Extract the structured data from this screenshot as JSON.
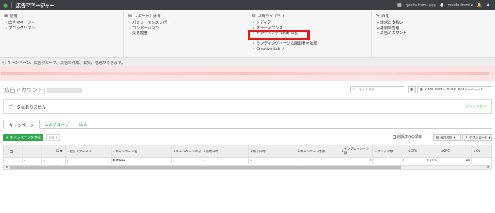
{
  "app": {
    "title": "広告マネージャー",
    "user1": "ryuuta izumi",
    "user1_role": "管理者",
    "user2": "ryuuta izumi ▾"
  },
  "menu": {
    "manage": {
      "heading": "管理",
      "items": [
        "広告マネージャー",
        "ブロックリスト"
      ]
    },
    "reports": {
      "heading": "レポートと計測",
      "items": [
        "パフォーマンスレポート",
        "コンバージョン",
        "変更履歴"
      ]
    },
    "library": {
      "heading": "共有ライブラリ",
      "items": [
        "メディア",
        "オーディエンス",
        "トラッキング(LINE Tag)",
        "",
        "ランディングページの画面審を依頼",
        "Creative Lab"
      ]
    },
    "settings": {
      "heading": "設定",
      "items": [
        "請求と支払い",
        "権限の管理",
        "広告アカウント"
      ]
    }
  },
  "info": {
    "notice": "キャンペーン、広告グループ、広告の作成、編集、管理ができます。"
  },
  "account": {
    "label": "広告アカウント:",
    "search_placeholder": "名前を検索",
    "date_range": "2020/10/9 - 2020/10/9",
    "timezone": "(Asia/Tokyo)"
  },
  "nodata": {
    "message": "データはありません",
    "right_link": "グラフを表示"
  },
  "tabs": [
    {
      "label": "キャンペーン",
      "active": true
    },
    {
      "label": "広告グループ",
      "active": false
    },
    {
      "label": "広告",
      "active": false
    }
  ],
  "toolbar": {
    "create_label": "キャンペーンを作成",
    "edit_label": "編集 ▾",
    "show_deleted": "削除済みの項目",
    "columns_label": "表示項目 ▾",
    "download_label": "ダウンロード ▾"
  },
  "table": {
    "headers": [
      "",
      "",
      "",
      "ID ◆",
      "配信ステータス",
      "キャンペーン名",
      "キャンペーン目的",
      "開始日時",
      "終了日時",
      "キャンペーン予算",
      "インプレッション数",
      "クリック数",
      "CTR",
      "CPC",
      "CV"
    ],
    "row": [
      "",
      "-",
      "-",
      "-",
      "-",
      "0 items",
      "-",
      "-",
      "-",
      "-",
      "0",
      "0",
      "0.00%",
      "¥0",
      ""
    ]
  },
  "icons": {
    "logo": "line-logo-icon",
    "notification": "bell-icon",
    "announce": "megaphone-icon",
    "search": "search-icon",
    "calendar": "calendar-icon"
  }
}
